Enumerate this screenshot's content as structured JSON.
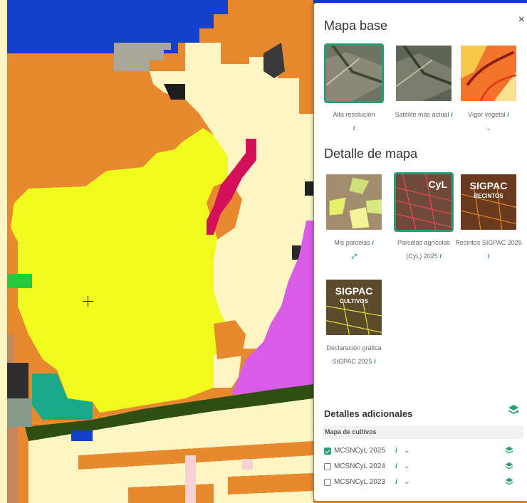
{
  "panel": {
    "close": "×",
    "base_title": "Mapa base",
    "base_tiles": [
      {
        "label": "Alta resolución",
        "info": "i",
        "selected": true
      },
      {
        "label": "Satélite más actual",
        "info": "i",
        "selected": false
      },
      {
        "label": "Vigor vegetal",
        "info": "i",
        "extra": "⌄",
        "selected": false
      }
    ],
    "detail_title": "Detalle de mapa",
    "detail_tiles": [
      {
        "label": "Mis parcelas",
        "info": "i",
        "extra": "⤢",
        "selected": false
      },
      {
        "label": "Parcelas agrícolas (CyL) 2025",
        "info": "i",
        "badge": "CyL",
        "selected": true
      },
      {
        "label": "Recintos SIGPAC 2025",
        "info": "i",
        "badge": "SIGPAC",
        "badge_sub": "RECINTOS",
        "selected": false
      },
      {
        "label": "Declaración gráfica SIGPAC 2025",
        "info": "i",
        "badge": "SIGPAC",
        "badge_sub": "CULTIVOS",
        "selected": false
      }
    ],
    "extra_title": "Detalles adicionales",
    "group_title": "Mapa de cultivos",
    "layers": [
      {
        "label": "MCSNCyL 2025",
        "checked": true
      },
      {
        "label": "MCSNCyL 2024",
        "checked": false
      },
      {
        "label": "MCSNCyL 2023",
        "checked": false
      }
    ]
  },
  "colors": {
    "accent": "#2a9d77",
    "map_orange": "#e8892f",
    "map_cream": "#fdf6c3",
    "map_yellow": "#f0fa1e",
    "map_blue": "#1340c8",
    "map_magenta": "#d85ce8",
    "map_crimson": "#d4105a",
    "map_darkgreen": "#2e4f12",
    "map_teal": "#18a88a"
  }
}
